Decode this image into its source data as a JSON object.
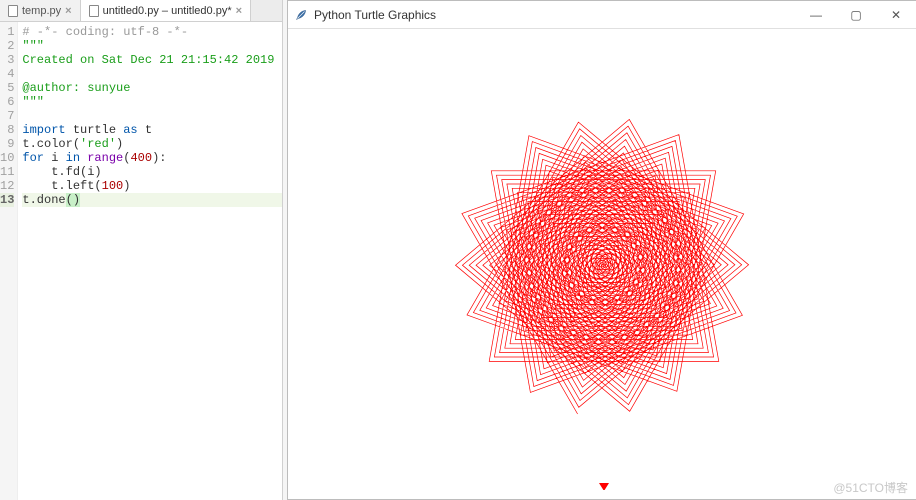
{
  "editor": {
    "tabs": [
      {
        "label": "temp.py",
        "active": false
      },
      {
        "label": "untitled0.py – untitled0.py*",
        "active": true
      }
    ],
    "current_line": 13,
    "code": [
      {
        "n": 1,
        "tokens": [
          {
            "t": "# -*- coding: utf-8 -*-",
            "cls": "c-cmt"
          }
        ]
      },
      {
        "n": 2,
        "tokens": [
          {
            "t": "\"\"\"",
            "cls": "c-str"
          }
        ]
      },
      {
        "n": 3,
        "tokens": [
          {
            "t": "Created on Sat Dec 21 21:15:42 2019",
            "cls": "c-str"
          }
        ]
      },
      {
        "n": 4,
        "tokens": []
      },
      {
        "n": 5,
        "tokens": [
          {
            "t": "@author: sunyue",
            "cls": "c-str"
          }
        ]
      },
      {
        "n": 6,
        "tokens": [
          {
            "t": "\"\"\"",
            "cls": "c-str"
          }
        ]
      },
      {
        "n": 7,
        "tokens": []
      },
      {
        "n": 8,
        "tokens": [
          {
            "t": "import",
            "cls": "c-kw"
          },
          {
            "t": " turtle ",
            "cls": ""
          },
          {
            "t": "as",
            "cls": "c-kw"
          },
          {
            "t": " t",
            "cls": ""
          }
        ]
      },
      {
        "n": 9,
        "tokens": [
          {
            "t": "t.color(",
            "cls": ""
          },
          {
            "t": "'red'",
            "cls": "c-str"
          },
          {
            "t": ")",
            "cls": ""
          }
        ]
      },
      {
        "n": 10,
        "tokens": [
          {
            "t": "for",
            "cls": "c-kw"
          },
          {
            "t": " i ",
            "cls": ""
          },
          {
            "t": "in",
            "cls": "c-kw"
          },
          {
            "t": " ",
            "cls": ""
          },
          {
            "t": "range",
            "cls": "c-blt"
          },
          {
            "t": "(",
            "cls": ""
          },
          {
            "t": "400",
            "cls": "c-num"
          },
          {
            "t": "):",
            "cls": ""
          }
        ]
      },
      {
        "n": 11,
        "tokens": [
          {
            "t": "    t.fd(i)",
            "cls": ""
          }
        ]
      },
      {
        "n": 12,
        "tokens": [
          {
            "t": "    t.left(",
            "cls": ""
          },
          {
            "t": "100",
            "cls": "c-num"
          },
          {
            "t": ")",
            "cls": ""
          }
        ]
      },
      {
        "n": 13,
        "tokens": [
          {
            "t": "t.done",
            "cls": ""
          },
          {
            "t": "(",
            "cls": "hl-par"
          },
          {
            "t": ")",
            "cls": "hl-par"
          }
        ]
      }
    ]
  },
  "turtle": {
    "title": "Python Turtle Graphics",
    "icon_name": "feather-icon",
    "draw": {
      "color": "#ff0000",
      "iterations": 400,
      "step_scale": 0.58,
      "turn_deg": 100
    },
    "window_buttons": {
      "minimize": "—",
      "maximize": "▢",
      "close": "✕"
    }
  },
  "watermark": "@51CTO博客"
}
